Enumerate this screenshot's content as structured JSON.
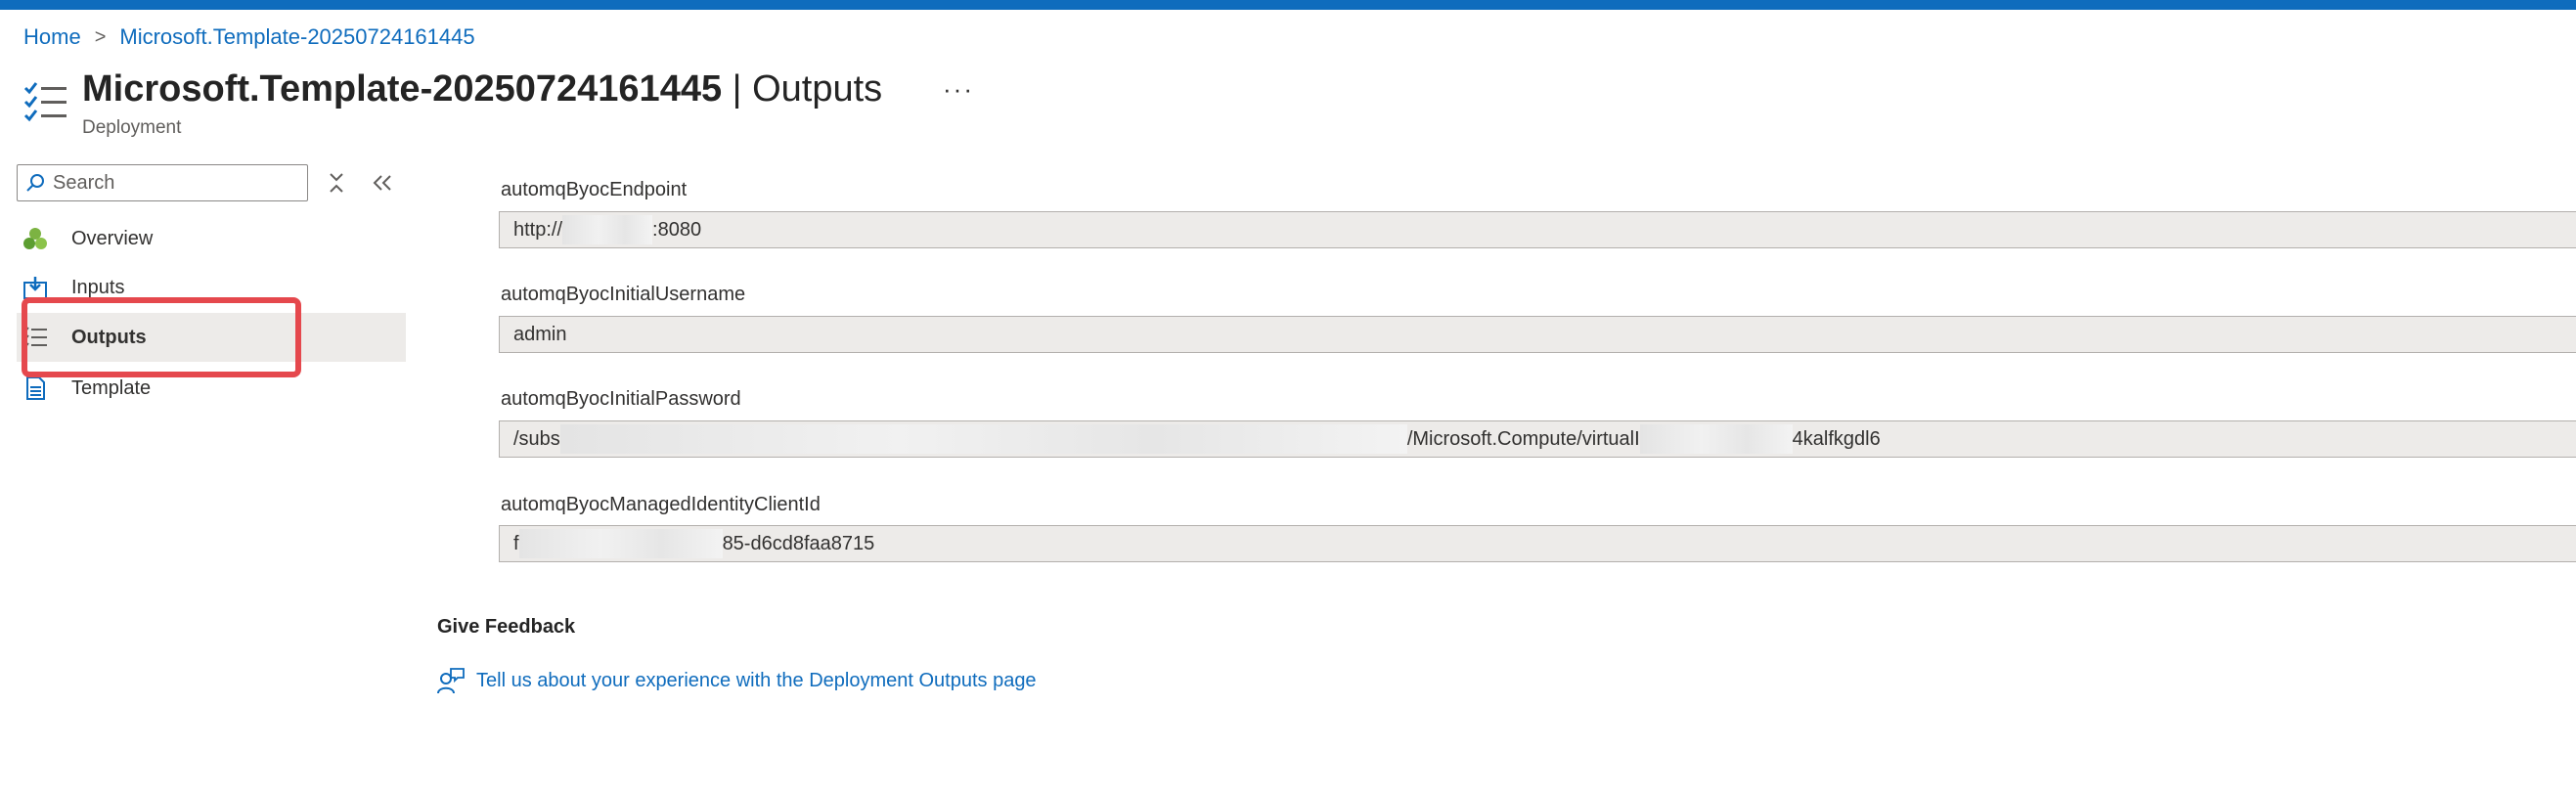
{
  "breadcrumb": {
    "home": "Home",
    "separator": ">",
    "current": "Microsoft.Template-20250724161445"
  },
  "header": {
    "title_bold": "Microsoft.Template-20250724161445",
    "title_rest": " | Outputs",
    "more": "···",
    "subtitle": "Deployment"
  },
  "sidebar": {
    "search_placeholder": "Search",
    "items": [
      {
        "label": "Overview",
        "icon": "overview-icon"
      },
      {
        "label": "Inputs",
        "icon": "inputs-icon"
      },
      {
        "label": "Outputs",
        "icon": "outputs-icon",
        "selected": true
      },
      {
        "label": "Template",
        "icon": "template-icon"
      }
    ]
  },
  "outputs": [
    {
      "label": "automqByocEndpoint",
      "value_start": "http://",
      "value_end": ":8080"
    },
    {
      "label": "automqByocInitialUsername",
      "value_start": "admin"
    },
    {
      "label": "automqByocInitialPassword",
      "value_start": "/subs",
      "value_middle": "/Microsoft.Compute/virtualI",
      "value_end": "4kalfkgdl6"
    },
    {
      "label": "automqByocManagedIdentityClientId",
      "value_start": "f",
      "value_end": "85-d6cd8faa8715"
    }
  ],
  "feedback": {
    "title": "Give Feedback",
    "link": "Tell us about your experience with the Deployment Outputs page"
  },
  "colors": {
    "accent": "#0f6cbd",
    "highlight": "#e5484d",
    "selected_bg": "#edebe9"
  }
}
